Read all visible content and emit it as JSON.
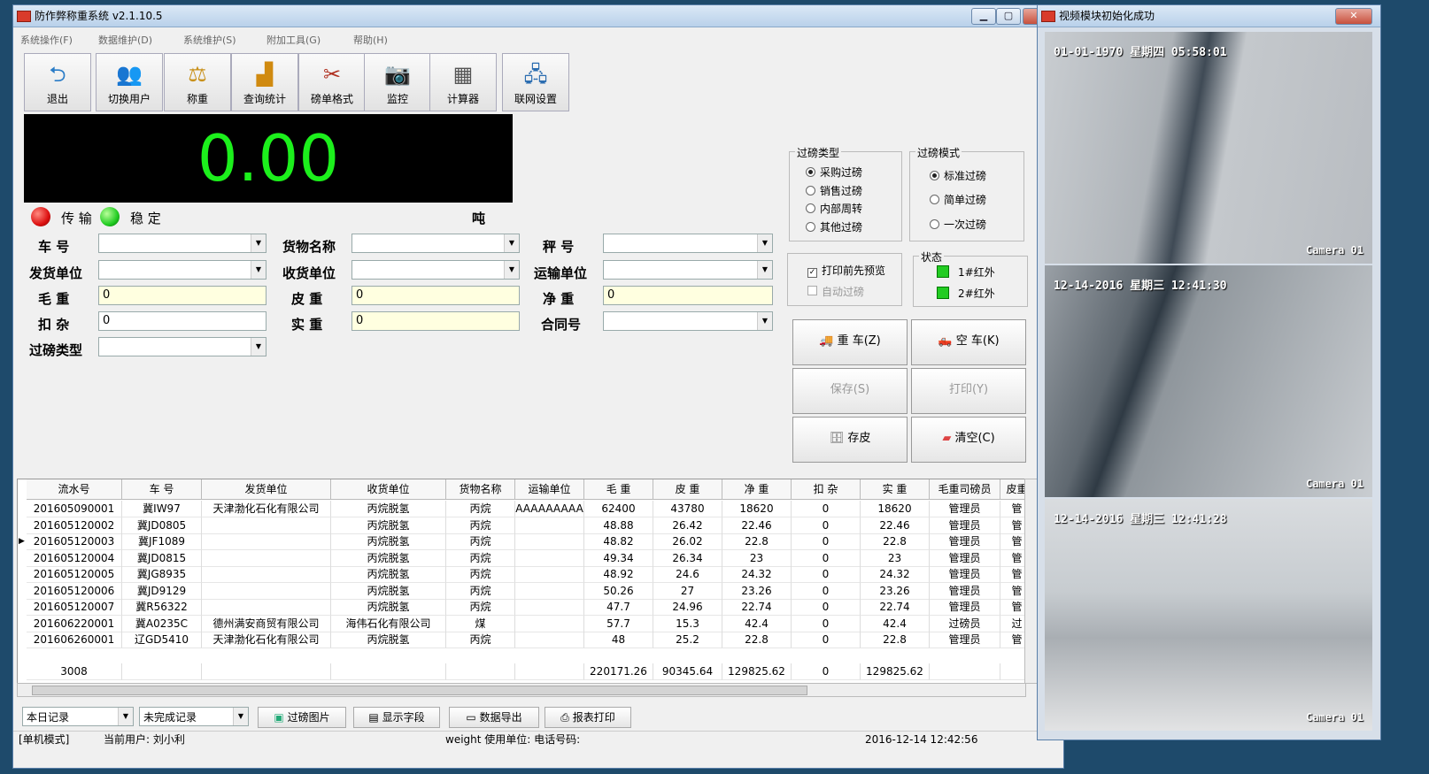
{
  "main_window": {
    "title": "防作弊称重系统 v2.1.10.5",
    "menu": [
      "系统操作(F)",
      "数据维护(D)",
      "系统维护(S)",
      "附加工具(G)",
      "帮助(H)"
    ],
    "toolbar": [
      "退出",
      "切换用户",
      "称重",
      "查询统计",
      "磅单格式",
      "监控",
      "计算器",
      "联网设置"
    ]
  },
  "scale": {
    "value": "0.00",
    "unit": "吨",
    "transmit_label": "传 输",
    "stable_label": "稳 定"
  },
  "form": {
    "labels": {
      "plate": "车 号",
      "goods": "货物名称",
      "scale_no": "秤 号",
      "shipper": "发货单位",
      "receiver": "收货单位",
      "carrier": "运输单位",
      "gross": "毛 重",
      "tare": "皮 重",
      "net": "净 重",
      "deduct": "扣 杂",
      "actual": "实 重",
      "contract": "合同号",
      "type": "过磅类型"
    },
    "values": {
      "gross": "0",
      "tare": "0",
      "net": "0",
      "deduct": "0",
      "actual": "0"
    }
  },
  "weigh_type": {
    "title": "过磅类型",
    "options": [
      "采购过磅",
      "销售过磅",
      "内部周转",
      "其他过磅"
    ],
    "selected": 0
  },
  "weigh_mode": {
    "title": "过磅模式",
    "options": [
      "标准过磅",
      "简单过磅",
      "一次过磅"
    ],
    "selected": 0
  },
  "options_box": {
    "print_preview": "打印前先预览",
    "auto_weigh": "自动过磅"
  },
  "status_box": {
    "title": "状态",
    "items": [
      "1#红外",
      "2#红外"
    ]
  },
  "buttons": {
    "heavy": "重 车(Z)",
    "empty": "空 车(K)",
    "save": "保存(S)",
    "print": "打印(Y)",
    "store_tare": "存皮",
    "clear": "清空(C)"
  },
  "table": {
    "headers": [
      "流水号",
      "车 号",
      "发货单位",
      "收货单位",
      "货物名称",
      "运输单位",
      "毛 重",
      "皮 重",
      "净 重",
      "扣 杂",
      "实 重",
      "毛重司磅员",
      "皮重"
    ],
    "rows": [
      [
        "201605090001",
        "冀IW97",
        "天津渤化石化有限公司",
        "丙烷脱氢",
        "丙烷",
        "AAAAAAAAA",
        "62400",
        "43780",
        "18620",
        "0",
        "18620",
        "管理员",
        "管"
      ],
      [
        "201605120002",
        "冀JD0805",
        "",
        "丙烷脱氢",
        "丙烷",
        "",
        "48.88",
        "26.42",
        "22.46",
        "0",
        "22.46",
        "管理员",
        "管"
      ],
      [
        "201605120003",
        "冀JF1089",
        "",
        "丙烷脱氢",
        "丙烷",
        "",
        "48.82",
        "26.02",
        "22.8",
        "0",
        "22.8",
        "管理员",
        "管"
      ],
      [
        "201605120004",
        "冀JD0815",
        "",
        "丙烷脱氢",
        "丙烷",
        "",
        "49.34",
        "26.34",
        "23",
        "0",
        "23",
        "管理员",
        "管"
      ],
      [
        "201605120005",
        "冀JG8935",
        "",
        "丙烷脱氢",
        "丙烷",
        "",
        "48.92",
        "24.6",
        "24.32",
        "0",
        "24.32",
        "管理员",
        "管"
      ],
      [
        "201605120006",
        "冀JD9129",
        "",
        "丙烷脱氢",
        "丙烷",
        "",
        "50.26",
        "27",
        "23.26",
        "0",
        "23.26",
        "管理员",
        "管"
      ],
      [
        "201605120007",
        "冀R56322",
        "",
        "丙烷脱氢",
        "丙烷",
        "",
        "47.7",
        "24.96",
        "22.74",
        "0",
        "22.74",
        "管理员",
        "管"
      ],
      [
        "201606220001",
        "冀A0235C",
        "德州满安商贸有限公司",
        "海伟石化有限公司",
        "煤",
        "",
        "57.7",
        "15.3",
        "42.4",
        "0",
        "42.4",
        "过磅员",
        "过"
      ],
      [
        "201606260001",
        "辽GD5410",
        "天津渤化石化有限公司",
        "丙烷脱氢",
        "丙烷",
        "",
        "48",
        "25.2",
        "22.8",
        "0",
        "22.8",
        "管理员",
        "管"
      ]
    ],
    "totals": [
      "3008",
      "",
      "",
      "",
      "",
      "",
      "220171.26",
      "90345.64",
      "129825.62",
      "0",
      "129825.62",
      "",
      ""
    ]
  },
  "bottom": {
    "filter1": "本日记录",
    "filter2": "未完成记录",
    "btn_images": "过磅图片",
    "btn_fields": "显示字段",
    "btn_export": "数据导出",
    "btn_print": "报表打印"
  },
  "statusbar": {
    "mode": "[单机模式]",
    "user": "当前用户: 刘小利",
    "unit": "weight 使用单位: 电话号码:",
    "datetime": "2016-12-14 12:42:56"
  },
  "video_window": {
    "title": "视频模块初始化成功",
    "cams": [
      {
        "timestamp": "01-01-1970 星期四 05:58:01",
        "label": "Camera 01"
      },
      {
        "timestamp": "12-14-2016 星期三 12:41:30",
        "label": "Camera 01"
      },
      {
        "timestamp": "12-14-2016 星期三 12:41:28",
        "label": "Camera 01"
      }
    ]
  }
}
